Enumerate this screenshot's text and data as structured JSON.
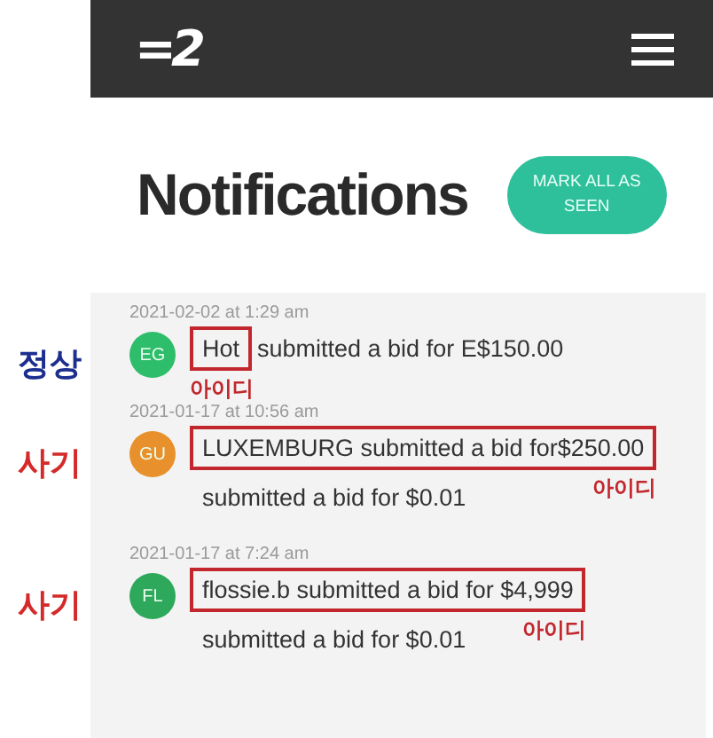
{
  "header": {
    "logo": "=2"
  },
  "title": "Notifications",
  "mark_all_button": "MARK ALL AS SEEN",
  "notifications": [
    {
      "time": "2021-02-02 at 1:29 am",
      "avatar": {
        "initials": "EG",
        "color": "#2ebd6b"
      },
      "label": {
        "text": "정상",
        "color": "#1c2f8f"
      },
      "lines": [
        [
          {
            "text": "Hot",
            "boxed": true,
            "tag": "아이디"
          },
          {
            "text": "submitted a bid for E$150.00",
            "boxed": false
          }
        ]
      ]
    },
    {
      "time": "2021-01-17 at 10:56 am",
      "avatar": {
        "initials": "GU",
        "color": "#e8912c"
      },
      "label": {
        "text": "사기",
        "color": "#d42a2a"
      },
      "lines": [
        [
          {
            "text": "LUXEMBURG submitted a bid for$250.00",
            "boxed": true,
            "tag": "아이디"
          }
        ],
        [
          {
            "text": "submitted a bid for $0.01",
            "boxed": false
          }
        ]
      ]
    },
    {
      "time": "2021-01-17 at 7:24 am",
      "avatar": {
        "initials": "FL",
        "color": "#2ea85a"
      },
      "label": {
        "text": "사기",
        "color": "#d42a2a"
      },
      "lines": [
        [
          {
            "text": "flossie.b submitted a bid for $4,999",
            "boxed": true,
            "tag": "아이디"
          }
        ],
        [
          {
            "text": "submitted a bid for $0.01",
            "boxed": false
          }
        ]
      ]
    }
  ]
}
